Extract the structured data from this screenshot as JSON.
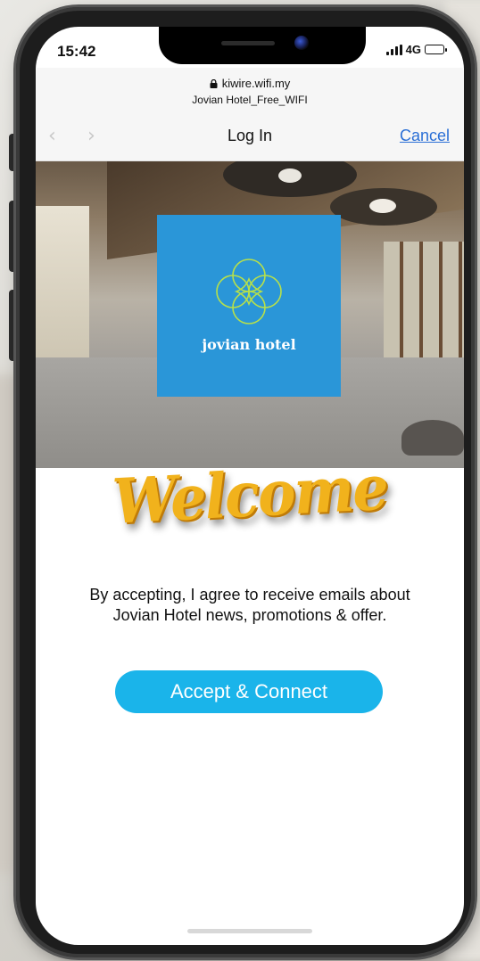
{
  "status_bar": {
    "time": "15:42",
    "network": "4G",
    "icons": [
      "signal-icon",
      "battery-icon"
    ]
  },
  "browser": {
    "url": "kiwire.wifi.my",
    "network_name": "Jovian Hotel_Free_WIFI",
    "nav": {
      "back_icon": "‹",
      "forward_icon": "›",
      "title": "Log In",
      "cancel_label": "Cancel"
    }
  },
  "hero": {
    "logo_text": "jovian hotel",
    "logo_color": "#2a96d8",
    "logo_mark_color": "#b7e04a"
  },
  "welcome": {
    "text": "Welcome",
    "color": "#f1b21c"
  },
  "consent": {
    "text": "By accepting, I agree to receive emails about Jovian Hotel news, promotions & offer."
  },
  "accept_button": {
    "label": "Accept & Connect",
    "color": "#1ab4ea"
  }
}
